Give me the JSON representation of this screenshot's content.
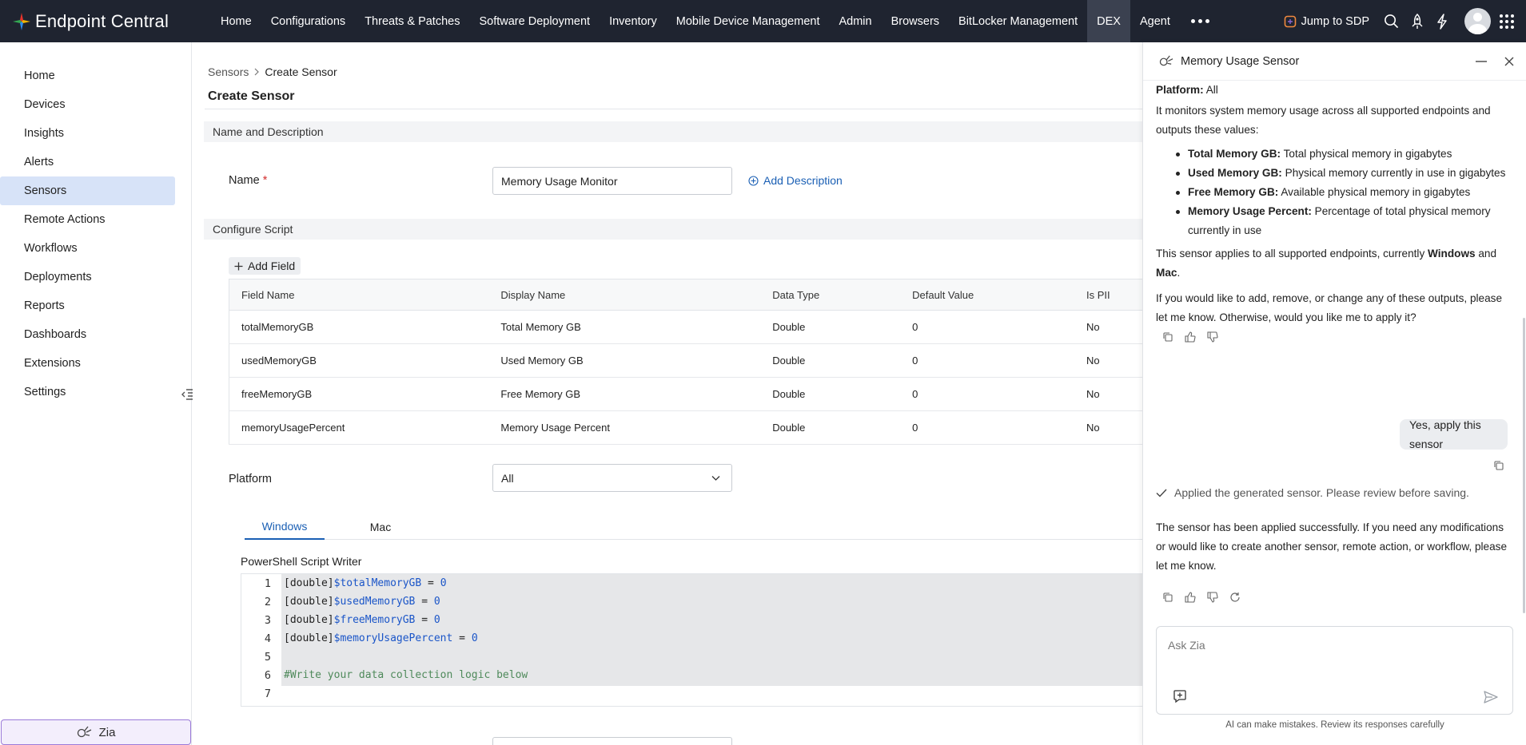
{
  "app": {
    "name": "Endpoint Central"
  },
  "topnav": {
    "items": [
      {
        "label": "Home"
      },
      {
        "label": "Configurations"
      },
      {
        "label": "Threats & Patches"
      },
      {
        "label": "Software Deployment"
      },
      {
        "label": "Inventory"
      },
      {
        "label": "Mobile Device Management"
      },
      {
        "label": "Admin"
      },
      {
        "label": "Browsers"
      },
      {
        "label": "BitLocker Management"
      },
      {
        "label": "DEX"
      },
      {
        "label": "Agent"
      }
    ],
    "active": "DEX",
    "jump_label": "Jump to SDP"
  },
  "sidebar": {
    "items": [
      {
        "label": "Home"
      },
      {
        "label": "Devices"
      },
      {
        "label": "Insights"
      },
      {
        "label": "Alerts"
      },
      {
        "label": "Sensors"
      },
      {
        "label": "Remote Actions"
      },
      {
        "label": "Workflows"
      },
      {
        "label": "Deployments"
      },
      {
        "label": "Reports"
      },
      {
        "label": "Dashboards"
      },
      {
        "label": "Extensions"
      },
      {
        "label": "Settings"
      }
    ],
    "active": "Sensors",
    "zia_label": "Zia"
  },
  "main": {
    "breadcrumb": {
      "parent": "Sensors",
      "current": "Create Sensor"
    },
    "title": "Create Sensor",
    "name_section": "Name and Description",
    "name_label": "Name",
    "required_mark": "*",
    "name_value": "Memory Usage Monitor",
    "add_description": "Add Description",
    "script_section": "Configure Script",
    "add_field": "Add Field",
    "table": {
      "headers": [
        "Field Name",
        "Display Name",
        "Data Type",
        "Default Value",
        "Is PII"
      ],
      "rows": [
        [
          "totalMemoryGB",
          "Total Memory GB",
          "Double",
          "0",
          "No"
        ],
        [
          "usedMemoryGB",
          "Used Memory GB",
          "Double",
          "0",
          "No"
        ],
        [
          "freeMemoryGB",
          "Free Memory GB",
          "Double",
          "0",
          "No"
        ],
        [
          "memoryUsagePercent",
          "Memory Usage Percent",
          "Double",
          "0",
          "No"
        ]
      ]
    },
    "platform_label": "Platform",
    "platform_value": "All",
    "tabs": [
      {
        "label": "Windows"
      },
      {
        "label": "Mac"
      }
    ],
    "active_tab": "Windows",
    "script_writer_title": "PowerShell Script Writer",
    "code_lines": [
      {
        "n": "1",
        "type": "[double]",
        "var": "$totalMemoryGB",
        "rest": " = ",
        "num": "0"
      },
      {
        "n": "2",
        "type": "[double]",
        "var": "$usedMemoryGB",
        "rest": " = ",
        "num": "0"
      },
      {
        "n": "3",
        "type": "[double]",
        "var": "$freeMemoryGB",
        "rest": " = ",
        "num": "0"
      },
      {
        "n": "4",
        "type": "[double]",
        "var": "$memoryUsagePercent",
        "rest": " = ",
        "num": "0"
      },
      {
        "n": "5"
      },
      {
        "n": "6",
        "comment": "#Write your data collection logic below"
      },
      {
        "n": "7"
      }
    ]
  },
  "panel": {
    "title": "Memory Usage Sensor",
    "platform_prefix": "Platform:",
    "platform_value": "All",
    "intro": "It monitors system memory usage across all supported endpoints and outputs these values:",
    "bullets": [
      {
        "term": "Total Memory GB:",
        "desc": "Total physical memory in gigabytes"
      },
      {
        "term": "Used Memory GB:",
        "desc": "Physical memory currently in use in gigabytes"
      },
      {
        "term": "Free Memory GB:",
        "desc": "Available physical memory in gigabytes"
      },
      {
        "term": "Memory Usage Percent:",
        "desc": "Percentage of total physical memory currently in use"
      }
    ],
    "applies_pre": "This sensor applies to all supported endpoints, currently",
    "applies_os1": "Windows",
    "applies_and": "and",
    "applies_os2": "Mac",
    "applies_end": ".",
    "question": "If you would like to add, remove, or change any of these outputs, please let me know. Otherwise, would you like me to apply it?",
    "user_message": "Yes, apply this sensor",
    "applied_notice": "Applied the generated sensor. Please review before saving.",
    "response": "The sensor has been applied successfully. If you need any modifications or would like to create another sensor, remote action, or workflow, please let me know.",
    "ask_placeholder": "Ask Zia",
    "disclaimer": "AI can make mistakes. Review its responses carefully"
  },
  "colors": {
    "topbar": "#1f2430",
    "accent": "#1a5fb4",
    "active_side": "#d7e3f8"
  }
}
